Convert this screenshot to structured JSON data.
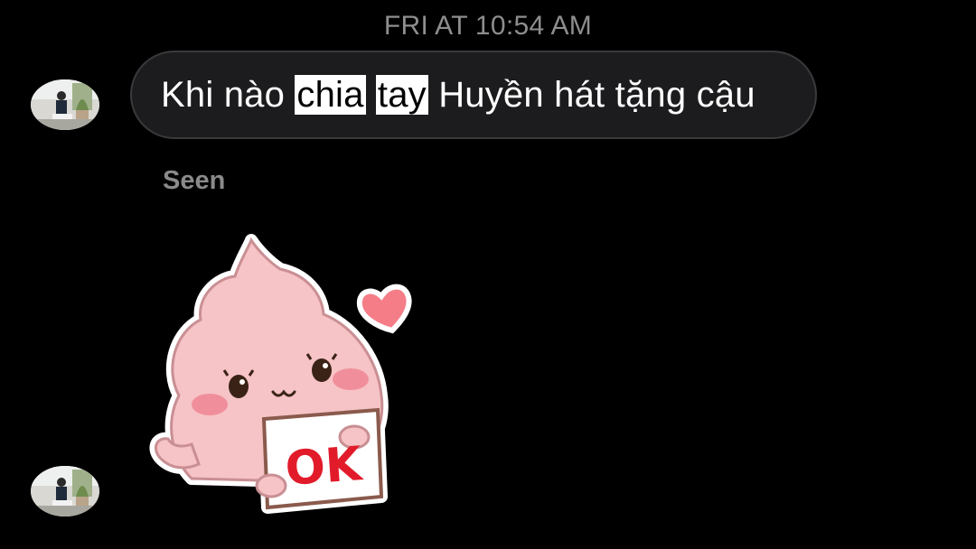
{
  "thread": {
    "timestamp": "FRI AT 10:54 AM",
    "message": {
      "parts": [
        "Khi nào ",
        "chia",
        " ",
        "tay",
        " Huyền hát tặng cậu"
      ]
    },
    "seen_label": "Seen",
    "sticker": {
      "text": "OK",
      "colors": {
        "body": "#f6c3c6",
        "outline": "#c98f93",
        "heart": "#f47d88",
        "ok_text": "#e21b2b"
      }
    }
  },
  "colors": {
    "background": "#000000",
    "bubble": "#1c1c1e",
    "bubble_border": "#3a3a3c",
    "timestamp": "#8e8e8e",
    "seen": "#8a8a8a"
  }
}
